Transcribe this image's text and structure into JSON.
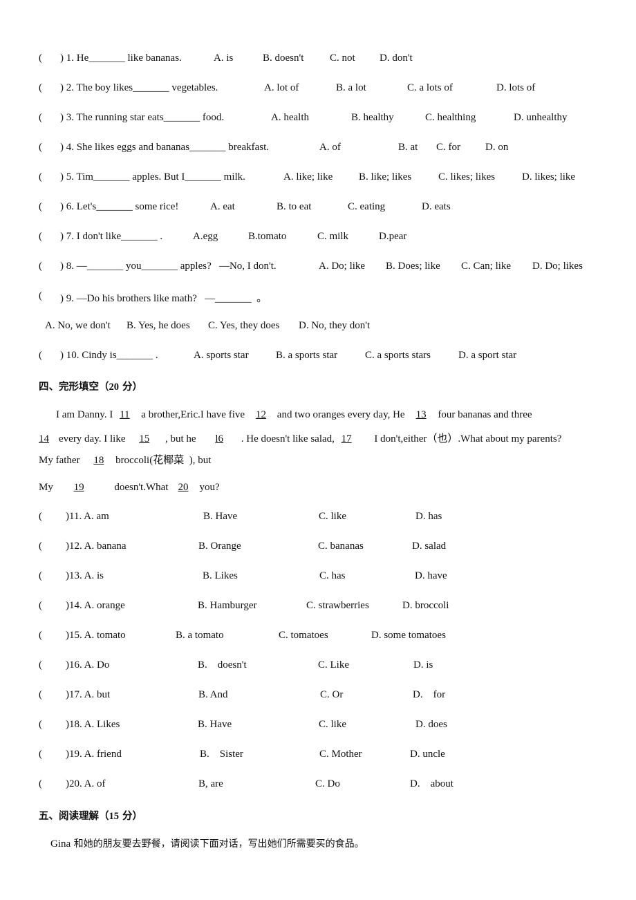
{
  "section3_mc": [
    {
      "num": "1",
      "stem": ") 1. He_______ like bananas.",
      "options": [
        "A. is",
        "B. doesn't",
        "C. not",
        "D. don't"
      ]
    },
    {
      "num": "2",
      "stem": ") 2. The boy likes_______ vegetables.",
      "options": [
        "A. lot of",
        "B. a lot",
        "C. a lots of",
        "D. lots of"
      ]
    },
    {
      "num": "3",
      "stem": ") 3. The running star eats_______ food.",
      "options": [
        "A. health",
        "B. healthy",
        "C. healthing",
        "D. unhealthy"
      ]
    },
    {
      "num": "4",
      "stem": ") 4. She likes eggs and bananas_______ breakfast.",
      "options": [
        "A. of",
        "B. at",
        "C. for",
        "D. on"
      ]
    },
    {
      "num": "5",
      "stem": ") 5. Tim_______ apples. But I_______ milk.",
      "options": [
        "A. like; like",
        "B. like; likes",
        "C. likes; likes",
        "D. likes; like"
      ]
    },
    {
      "num": "6",
      "stem": ") 6. Let's_______ some rice!",
      "options": [
        "A. eat",
        "B. to eat",
        "C. eating",
        "D. eats"
      ]
    },
    {
      "num": "7",
      "stem": ") 7. I don't like_______ .",
      "options": [
        "A.egg",
        "B.tomato",
        "C. milk",
        "D.pear"
      ]
    },
    {
      "num": "8",
      "stem": ") 8. —_______ you_______ apples?   —No, I don't.",
      "options": [
        "A. Do; like",
        "B. Does; like",
        "C. Can; like",
        "D. Do; likes"
      ]
    },
    {
      "num": "9",
      "stem": ") 9. —Do his brothers like math?   —_______  。",
      "options": [
        "A. No, we don't",
        "B. Yes, he does",
        "C. Yes, they does",
        "D. No, they don't"
      ]
    },
    {
      "num": "10",
      "stem": ") 10. Cindy is_______ .",
      "options": [
        "A. sports star",
        "B. a sports star",
        "C. a sports stars",
        "D. a sport star"
      ]
    }
  ],
  "paren_open": "(",
  "section4": {
    "title_cn": "四、完形填空（",
    "title_pts": "20",
    "title_tail": " 分）",
    "passage": {
      "l1": [
        "I am Danny. I ",
        "11",
        " a brother,Eric.I have five",
        "12",
        " and two oranges every day, He",
        "13",
        " four bananas and three"
      ],
      "l2": [
        "14",
        "every day. I like ",
        "15",
        " , but he ",
        "l6",
        " . He doesn't like salad, ",
        "17",
        " I don't,either（也）.What about my parents?"
      ],
      "l3": [
        "My father ",
        "18",
        " broccoli(花椰菜  ), but"
      ],
      "l4": [
        "My ",
        "19",
        " doesn't.What",
        "20",
        "you?"
      ]
    },
    "questions": [
      {
        "label": ")11. A. am",
        "b": "B. Have",
        "c": "C. like",
        "d": "D. has"
      },
      {
        "label": ")12. A. banana",
        "b": "B. Orange",
        "c": "C. bananas",
        "d": "D. salad"
      },
      {
        "label": ")13. A. is",
        "b": "B. Likes",
        "c": "C. has",
        "d": "D. have"
      },
      {
        "label": ")14. A. orange",
        "b": "B. Hamburger",
        "c": "C. strawberries",
        "d": "D. broccoli"
      },
      {
        "label": ")15. A. tomato",
        "b": "B. a tomato",
        "c": "C. tomatoes",
        "d": "D. some tomatoes"
      },
      {
        "label": ")16. A. Do",
        "b": "B.    doesn't",
        "c": "C. Like",
        "d": "D. is"
      },
      {
        "label": ")17. A. but",
        "b": "B. And",
        "c": "C. Or",
        "d": "D.    for"
      },
      {
        "label": ")18. A. Likes",
        "b": "B. Have",
        "c": "C. like",
        "d": "D. does"
      },
      {
        "label": ")19. A. friend",
        "b": "B.    Sister",
        "c": "C. Mother",
        "d": "D. uncle"
      },
      {
        "label": ")20. A. of",
        "b": "B, are",
        "c": "C. Do",
        "d": "D.    about"
      }
    ]
  },
  "section5": {
    "title_cn": "五、阅读理解（",
    "title_pts": "15",
    "title_tail": " 分）",
    "intro_name": "Gina",
    "intro_text": " 和她的朋友要去野餐，请阅读下面对话，写出她们所需要买的食品。"
  }
}
